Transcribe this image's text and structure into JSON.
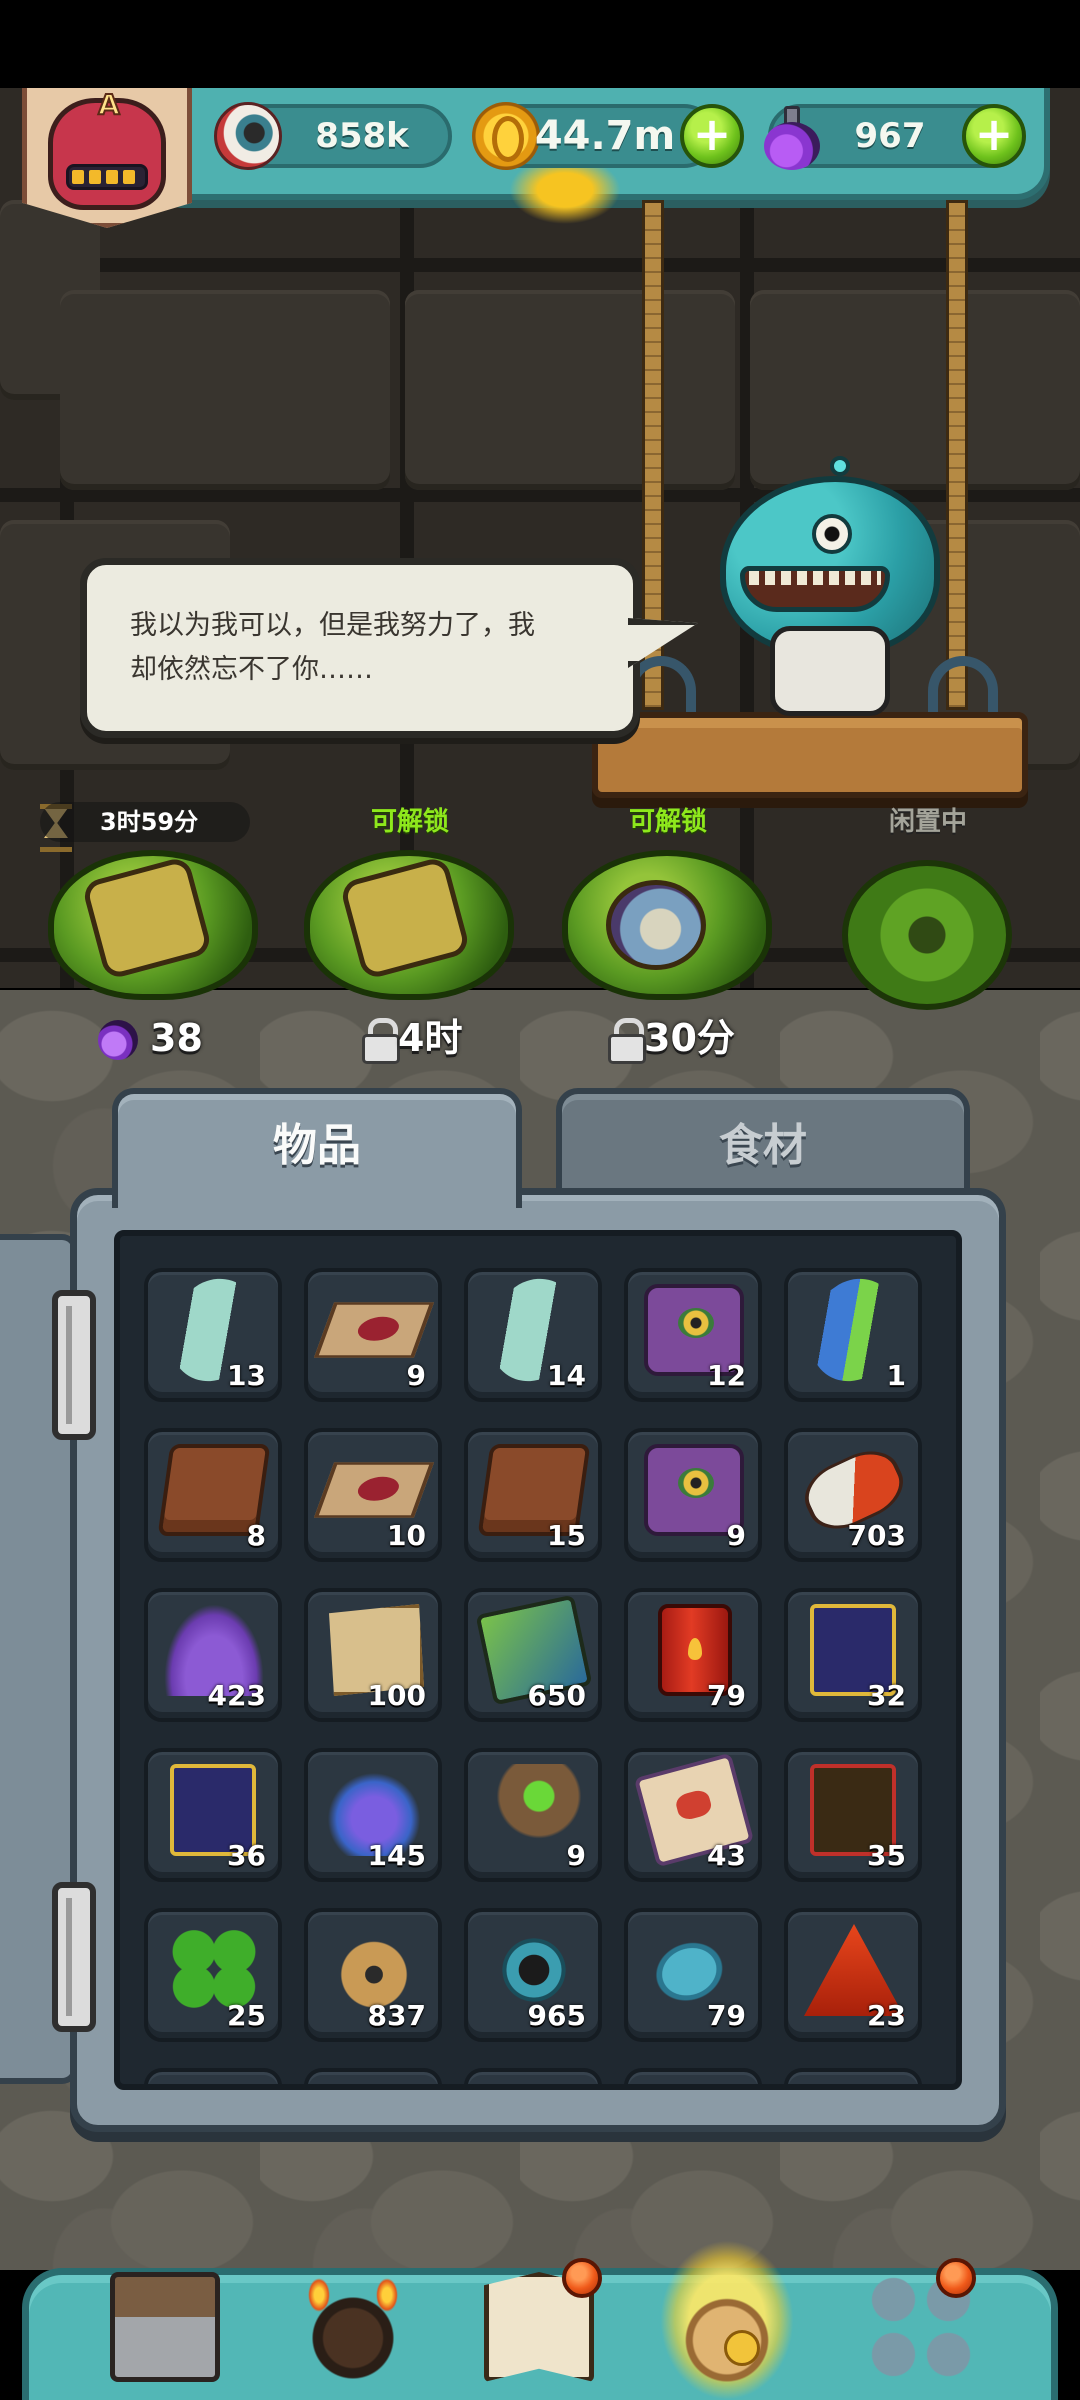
{
  "resources": {
    "eyeballs": "858k",
    "coins": "44.7m",
    "potions": "967"
  },
  "avatar": {
    "badge_letter": "A"
  },
  "dialogue": {
    "line1": "我以为我可以，但是我努力了，我",
    "line2": "却依然忘不了你……"
  },
  "slots": [
    {
      "status": "3时59分",
      "bottom": "38",
      "bottom_icon": "potion-icon"
    },
    {
      "status": "可解锁",
      "bottom": "4时",
      "bottom_icon": "lock-icon"
    },
    {
      "status": "可解锁",
      "bottom": "30分",
      "bottom_icon": "lock-icon"
    },
    {
      "status": "闲置中",
      "bottom": ""
    }
  ],
  "tabs": {
    "items": "物品",
    "food": "食材",
    "active": "物品"
  },
  "inventory": [
    {
      "icon": "message-bottle-icon",
      "qty": "13"
    },
    {
      "icon": "treasure-cloth-icon",
      "qty": "9"
    },
    {
      "icon": "message-bottle-icon",
      "qty": "14"
    },
    {
      "icon": "eye-tome-icon",
      "qty": "12"
    },
    {
      "icon": "blue-bottle-icon",
      "qty": "1"
    },
    {
      "icon": "leather-icon",
      "qty": "8"
    },
    {
      "icon": "treasure-cloth-icon",
      "qty": "10"
    },
    {
      "icon": "leather-icon",
      "qty": "15"
    },
    {
      "icon": "eye-tome-icon",
      "qty": "9"
    },
    {
      "icon": "capsule-icon",
      "qty": "703"
    },
    {
      "icon": "purple-powder-icon",
      "qty": "423"
    },
    {
      "icon": "parchment-map-icon",
      "qty": "100"
    },
    {
      "icon": "card-pack-icon",
      "qty": "650"
    },
    {
      "icon": "fuel-barrel-icon",
      "qty": "79"
    },
    {
      "icon": "tarot-card-icon",
      "qty": "32"
    },
    {
      "icon": "cauldron-card-icon",
      "qty": "36"
    },
    {
      "icon": "crystal-cluster-icon",
      "qty": "145"
    },
    {
      "icon": "ore-rock-icon",
      "qty": "9"
    },
    {
      "icon": "recipe-scroll-icon",
      "qty": "43"
    },
    {
      "icon": "monster-card-icon",
      "qty": "35"
    },
    {
      "icon": "clover-icon",
      "qty": "25"
    },
    {
      "icon": "monster-jar-icon",
      "qty": "837"
    },
    {
      "icon": "ring-portal-icon",
      "qty": "965"
    },
    {
      "icon": "fish-token-icon",
      "qty": "79"
    },
    {
      "icon": "fire-gem-icon",
      "qty": "23"
    }
  ],
  "bottom_nav": [
    {
      "name": "shop",
      "icon": "shop-icon",
      "badge": false
    },
    {
      "name": "forge",
      "icon": "forge-icon",
      "badge": false
    },
    {
      "name": "recipe-book",
      "icon": "book-icon",
      "badge": true
    },
    {
      "name": "bag",
      "icon": "bag-icon",
      "badge": false,
      "active": true
    },
    {
      "name": "more",
      "icon": "grid-icon",
      "badge": true
    }
  ],
  "colors": {
    "teal_ui": "#52b7b6",
    "unlock_green": "#8ee81c",
    "panel_gray": "#8b9ba6"
  }
}
